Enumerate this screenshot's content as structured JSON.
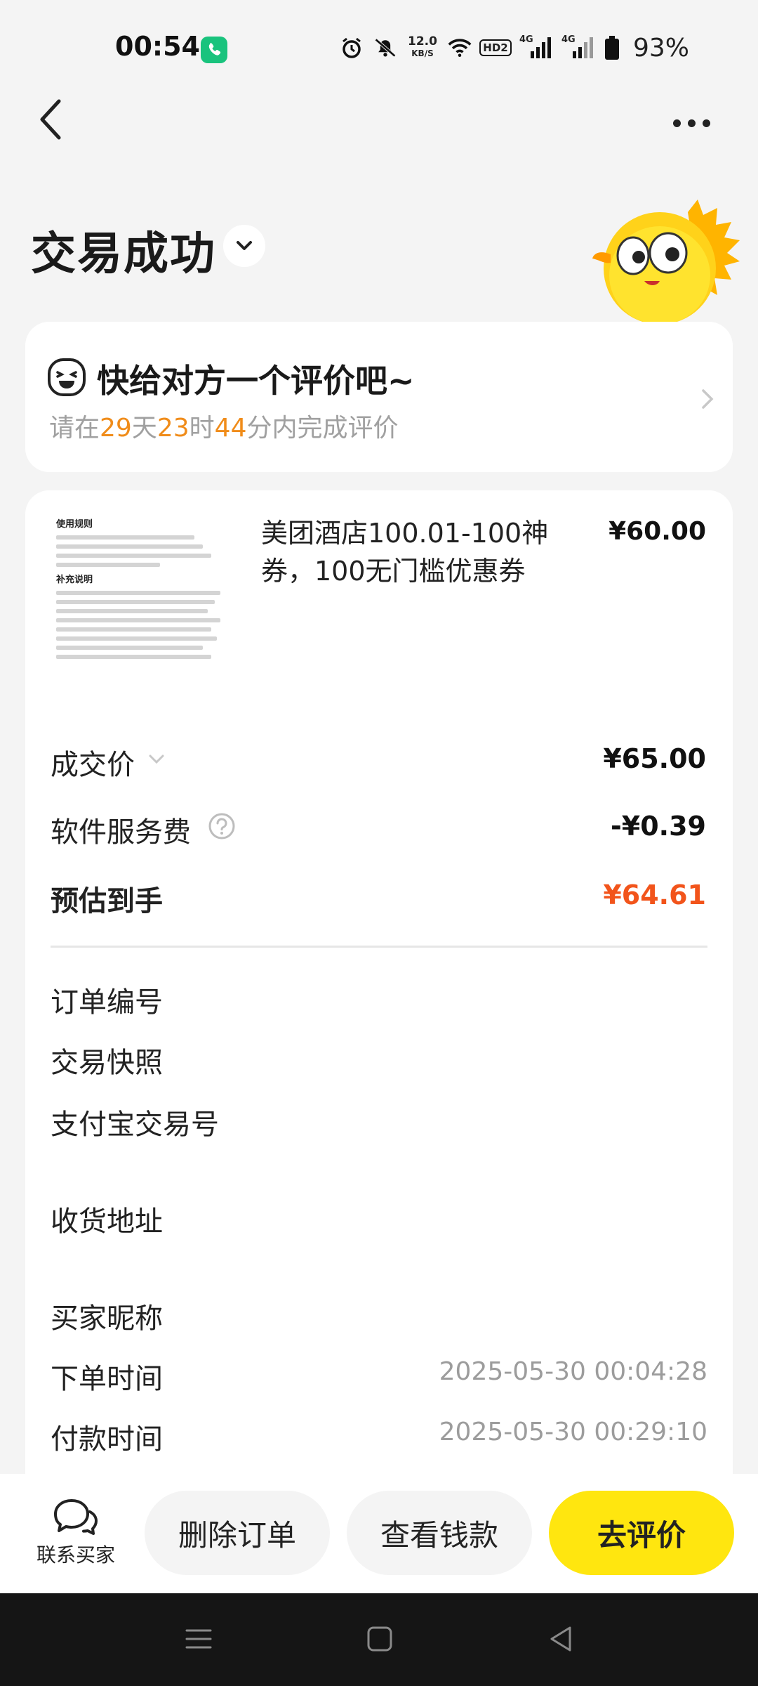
{
  "status_bar": {
    "time": "00:54",
    "net_speed_value": "12.0",
    "net_speed_unit": "KB/S",
    "battery": "93%",
    "signal_1": "4G",
    "signal_2": "4G",
    "hd": "HD2"
  },
  "header": {
    "title": "交易成功"
  },
  "rating_card": {
    "title": "快给对方一个评价吧~",
    "sub_prefix": "请在",
    "days": "29",
    "days_unit": "天",
    "hours": "23",
    "hours_unit": "时",
    "minutes": "44",
    "minutes_unit": "分内完成评价"
  },
  "product": {
    "name": "美团酒店100.01-100神券，100无门槛优惠券",
    "price": "¥60.00",
    "thumb_heading": "使用规则",
    "thumb_heading2": "补充说明"
  },
  "price_rows": {
    "deal_label": "成交价",
    "deal_value": "¥65.00",
    "fee_label": "软件服务费",
    "fee_value": "-¥0.39",
    "net_label": "预估到手",
    "net_value": "¥64.61"
  },
  "order_info": {
    "order_no_label": "订单编号",
    "snapshot_label": "交易快照",
    "alipay_label": "支付宝交易号",
    "address_label": "收货地址",
    "buyer_label": "买家昵称",
    "order_time_label": "下单时间",
    "order_time_value": "2025-05-30 00:04:28",
    "pay_time_label": "付款时间",
    "pay_time_value": "2025-05-30 00:29:10"
  },
  "bottom_bar": {
    "contact_label": "联系买家",
    "delete_label": "删除订单",
    "view_money_label": "查看钱款",
    "review_label": "去评价"
  },
  "colors": {
    "accent_yellow": "#ffe60f",
    "highlight_orange": "#f08c1a",
    "net_red": "#f2541b",
    "call_green": "#19c37d"
  }
}
